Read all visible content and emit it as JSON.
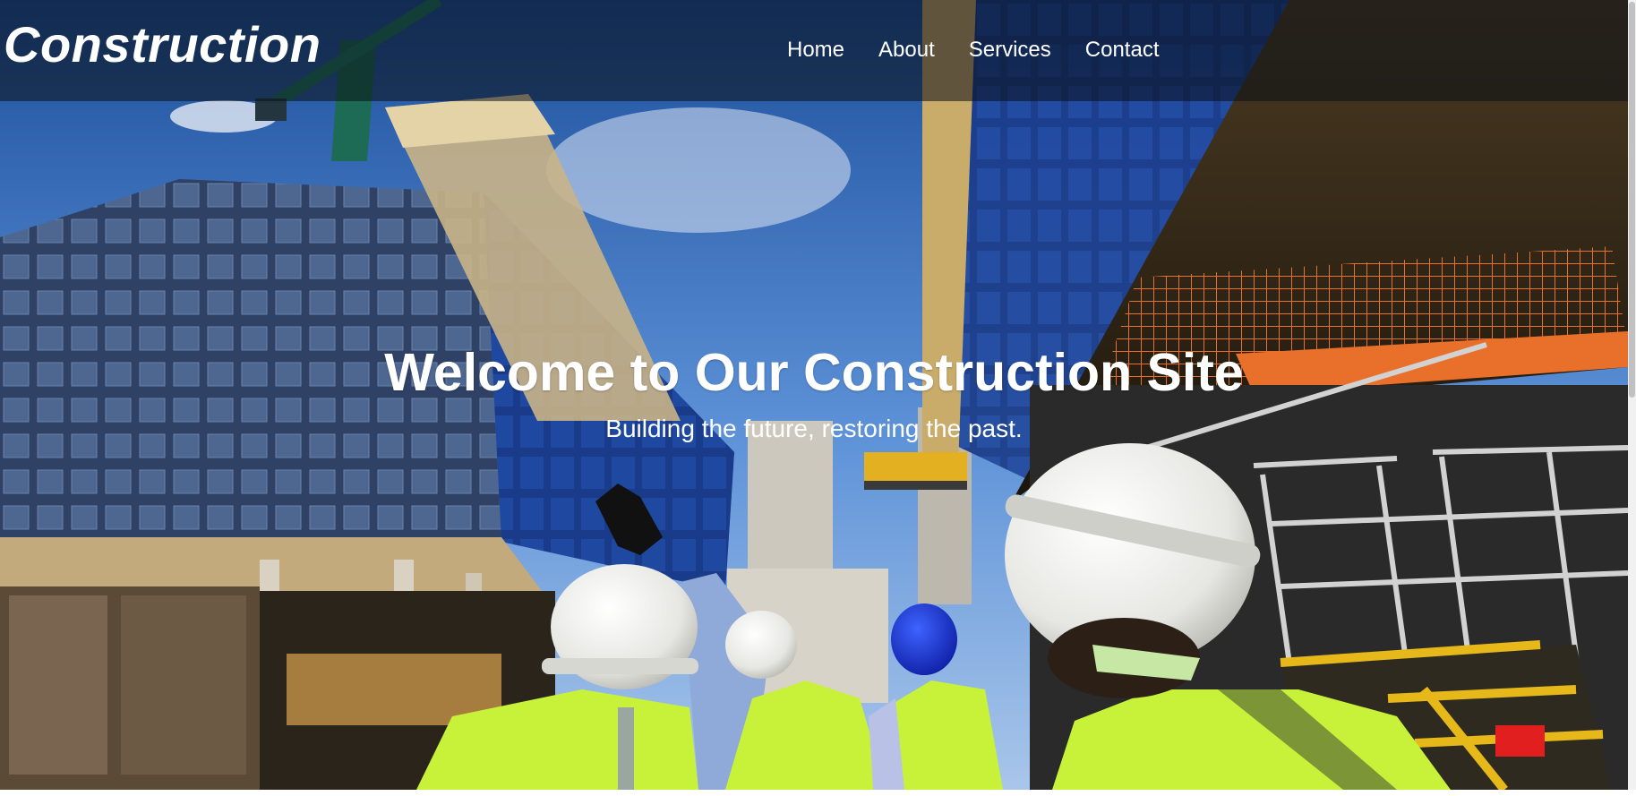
{
  "site": {
    "logo_text": "Construction"
  },
  "nav": {
    "items": [
      {
        "label": "Home"
      },
      {
        "label": "About"
      },
      {
        "label": "Services"
      },
      {
        "label": "Contact"
      }
    ]
  },
  "hero": {
    "title": "Welcome to Our Construction Site",
    "subtitle": "Building the future, restoring the past.",
    "background": "construction site photo: glass office towers, crane, workers in hard hats and hi-vis vests"
  },
  "colors": {
    "navbar_overlay": "#0a0e16",
    "text": "#ffffff",
    "sky": "#3f78c8",
    "vest": "#c8f23a",
    "railing_orange": "#e8702a"
  }
}
